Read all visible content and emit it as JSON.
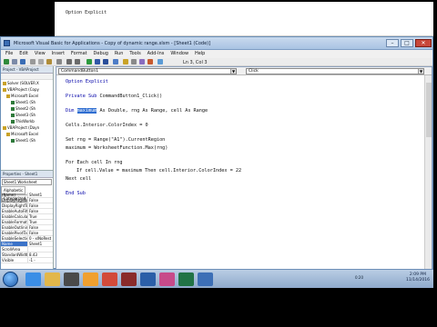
{
  "editor_top": {
    "option_line": "Option Explicit"
  },
  "window": {
    "title": "Microsoft Visual Basic for Applications - Copy of dynamic range.xlsm - [Sheet1 (Code)]"
  },
  "menus": [
    "File",
    "Edit",
    "View",
    "Insert",
    "Format",
    "Debug",
    "Run",
    "Tools",
    "Add-Ins",
    "Window",
    "Help"
  ],
  "toolbar": {
    "position": "Ln 3, Col 3"
  },
  "project": {
    "header": "Project - VBAProject",
    "tree": [
      "Solver (SOLVER.X",
      "VBAProject (Copy",
      "Microsoft Excel",
      "Sheet1 (Sh",
      "Sheet2 (Sh",
      "Sheet3 (Sh",
      "ThisWorkb",
      "VBAProject (Dayn",
      "Microsoft Excel",
      "Sheet1 (Sh"
    ]
  },
  "properties": {
    "header": "Properties - Sheet1",
    "object": "Sheet1 Worksheet",
    "tabs": [
      "Alphabetic",
      "Categorized"
    ],
    "rows": [
      {
        "k": "(Name)",
        "v": "Sheet1"
      },
      {
        "k": "DisplayPageBreaks",
        "v": "False"
      },
      {
        "k": "DisplayRightToLeft",
        "v": "False"
      },
      {
        "k": "EnableAutoFilter",
        "v": "False"
      },
      {
        "k": "EnableCalculation",
        "v": "True"
      },
      {
        "k": "EnableFormatConditi",
        "v": "True"
      },
      {
        "k": "EnableOutlining",
        "v": "False"
      },
      {
        "k": "EnablePivotTable",
        "v": "False"
      },
      {
        "k": "EnableSelection",
        "v": "0 - xlNoRest"
      },
      {
        "k": "Name",
        "v": "Sheet1"
      },
      {
        "k": "ScrollArea",
        "v": ""
      },
      {
        "k": "StandardWidth",
        "v": "8.43"
      },
      {
        "k": "Visible",
        "v": "-1 - xlSheetVi"
      }
    ]
  },
  "code": {
    "object_combo": "CommandButton1",
    "proc_combo": "Click",
    "lines": {
      "l1": "Option Explicit",
      "l2a": "Private Sub ",
      "l2b": "CommandButton1_Click()",
      "l3a": "Dim ",
      "l3sel": "maximum",
      "l3b": " As Double, rng As Range, cell As Range",
      "l4": "Cells.Interior.ColorIndex = 0",
      "l5": "Set rng = Range(\"A1\").CurrentRegion",
      "l6": "maximum = WorksheetFunction.Max(rng)",
      "l7": "For Each cell In rng",
      "l8": "If cell.Value = maximum Then cell.Interior.ColorIndex = 22",
      "l9": "Next cell",
      "l10": "End Sub"
    }
  },
  "taskbar": {
    "time": "2:09 PM",
    "date": "11/14/2016",
    "tray_time": "0:20"
  },
  "colors": {
    "accent": "#2f6ed1",
    "keyword": "#0000a8"
  }
}
